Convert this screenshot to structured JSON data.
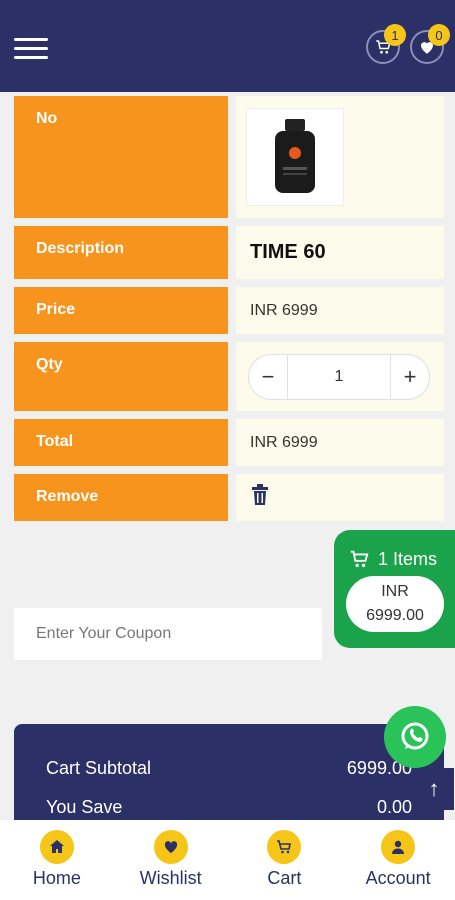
{
  "header": {
    "cart_badge": "1",
    "wishlist_badge": "0"
  },
  "table": {
    "no_label": "No",
    "description_label": "Description",
    "description_value": "TIME 60",
    "price_label": "Price",
    "price_value": "INR 6999",
    "qty_label": "Qty",
    "qty_minus": "−",
    "qty_value": "1",
    "qty_plus": "+",
    "total_label": "Total",
    "total_value": "INR 6999",
    "remove_label": "Remove"
  },
  "coupon": {
    "placeholder": "Enter Your Coupon"
  },
  "floating_cart": {
    "items": "1 Items",
    "currency": "INR",
    "amount": "6999.00"
  },
  "totals": {
    "subtotal_label": "Cart Subtotal",
    "subtotal_value": "6999.00",
    "save_label": "You Save",
    "save_value": "0.00"
  },
  "bottom_nav": {
    "home": "Home",
    "wishlist": "Wishlist",
    "cart": "Cart",
    "account": "Account"
  },
  "colors": {
    "brand": "#2b3166",
    "accent": "#f7941d",
    "badge": "#f5c518",
    "success": "#1aa34a"
  }
}
